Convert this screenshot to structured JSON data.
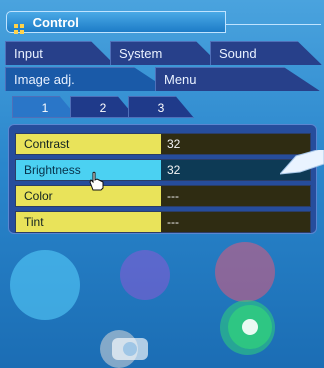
{
  "title": "Control",
  "main_tabs": [
    {
      "label": "Input"
    },
    {
      "label": "System"
    },
    {
      "label": "Sound"
    }
  ],
  "sub_tabs": [
    {
      "label": "Image adj."
    },
    {
      "label": "Menu"
    }
  ],
  "page_tabs": [
    {
      "label": "1"
    },
    {
      "label": "2"
    },
    {
      "label": "3"
    }
  ],
  "rows": [
    {
      "label": "Contrast",
      "value": "32"
    },
    {
      "label": "Brightness",
      "value": "32"
    },
    {
      "label": "Color",
      "value": "---"
    },
    {
      "label": "Tint",
      "value": "---"
    }
  ],
  "colors": {
    "accent_yellow": "#e9e35a",
    "selected_cyan": "#4bd1f2",
    "panel_blue": "#264d9c"
  },
  "icons": [
    "grid-icon",
    "hand-cursor-icon",
    "callout-icon",
    "camera-icon",
    "gear-camera-icon"
  ]
}
